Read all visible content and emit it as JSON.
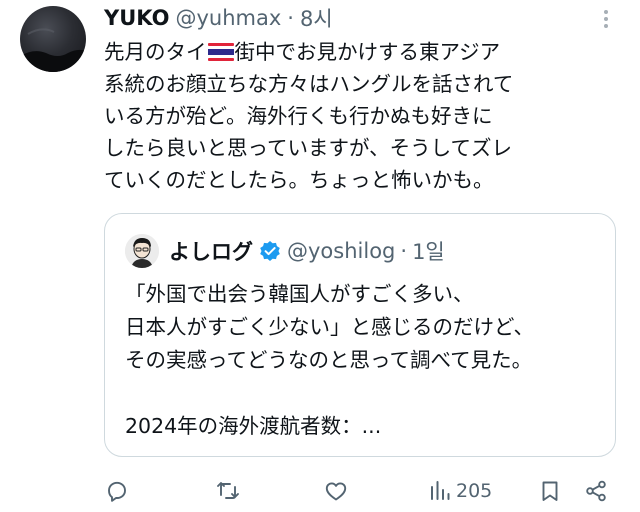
{
  "tweet": {
    "author_name": "YUKO",
    "author_handle": "@yuhmax",
    "separator": "·",
    "time": "8시",
    "text_lines": [
      "先月のタイ",
      "街中でお見かけする東アジア",
      "系統のお顔立ちな方々はハングルを話されて",
      "いる方が殆ど。海外行くも行かぬも好きに",
      "したら良いと思っていますが、そうしてズレ",
      "ていくのだとしたら。ちょっと怖いかも。"
    ],
    "flag": "thailand-flag"
  },
  "quote": {
    "author_name": "よしログ",
    "author_handle": "@yoshilog",
    "separator": "·",
    "time": "1일",
    "verified": true,
    "text_lines": [
      "「外国で出会う韓国人がすごく多い、",
      "日本人がすごく少ない」と感じるのだけど、",
      "その実感ってどうなのと思って調べて見た。",
      "",
      "2024年の海外渡航者数：..."
    ]
  },
  "actions": {
    "views_count": "205",
    "icons": [
      "reply-icon",
      "retweet-icon",
      "like-icon",
      "views-icon",
      "bookmark-icon",
      "share-icon"
    ]
  },
  "colors": {
    "text": "#0f1419",
    "secondary": "#536471",
    "border": "#cfd9de",
    "verified": "#1d9bf0"
  }
}
